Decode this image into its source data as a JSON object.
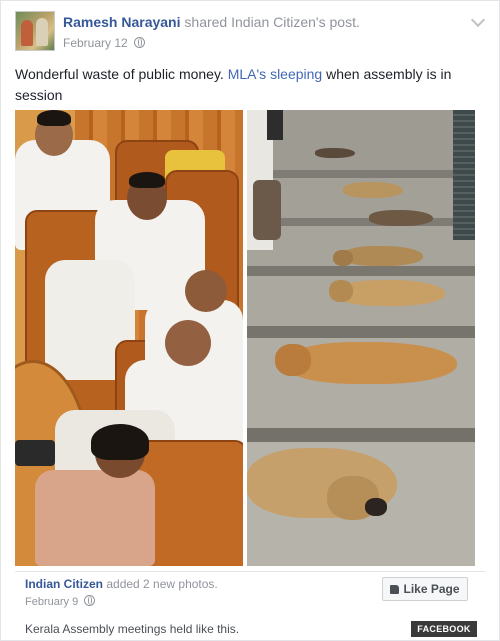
{
  "post": {
    "poster_name": "Ramesh Narayani",
    "shared_text": "shared Indian Citizen's post.",
    "date": "February 12",
    "text_before": "Wonderful waste of public money. ",
    "text_highlight_1": "MLA's",
    "text_middle": " ",
    "text_highlight_2": "sleeping",
    "text_after": " when assembly is in session"
  },
  "photos": [
    {
      "name": "assembly-photo",
      "icon": "photo-icon"
    },
    {
      "name": "dogs-sleeping-photo",
      "icon": "photo-icon"
    }
  ],
  "shared_post": {
    "page_name": "Indian Citizen",
    "added_text": "added 2 new photos.",
    "date": "February 9",
    "caption": "Kerala Assembly meetings held like this.",
    "like_button": "Like Page"
  },
  "badge": "FACEBOOK",
  "colors": {
    "link": "#365899",
    "muted": "#90949c",
    "highlight": "#4267b2"
  }
}
